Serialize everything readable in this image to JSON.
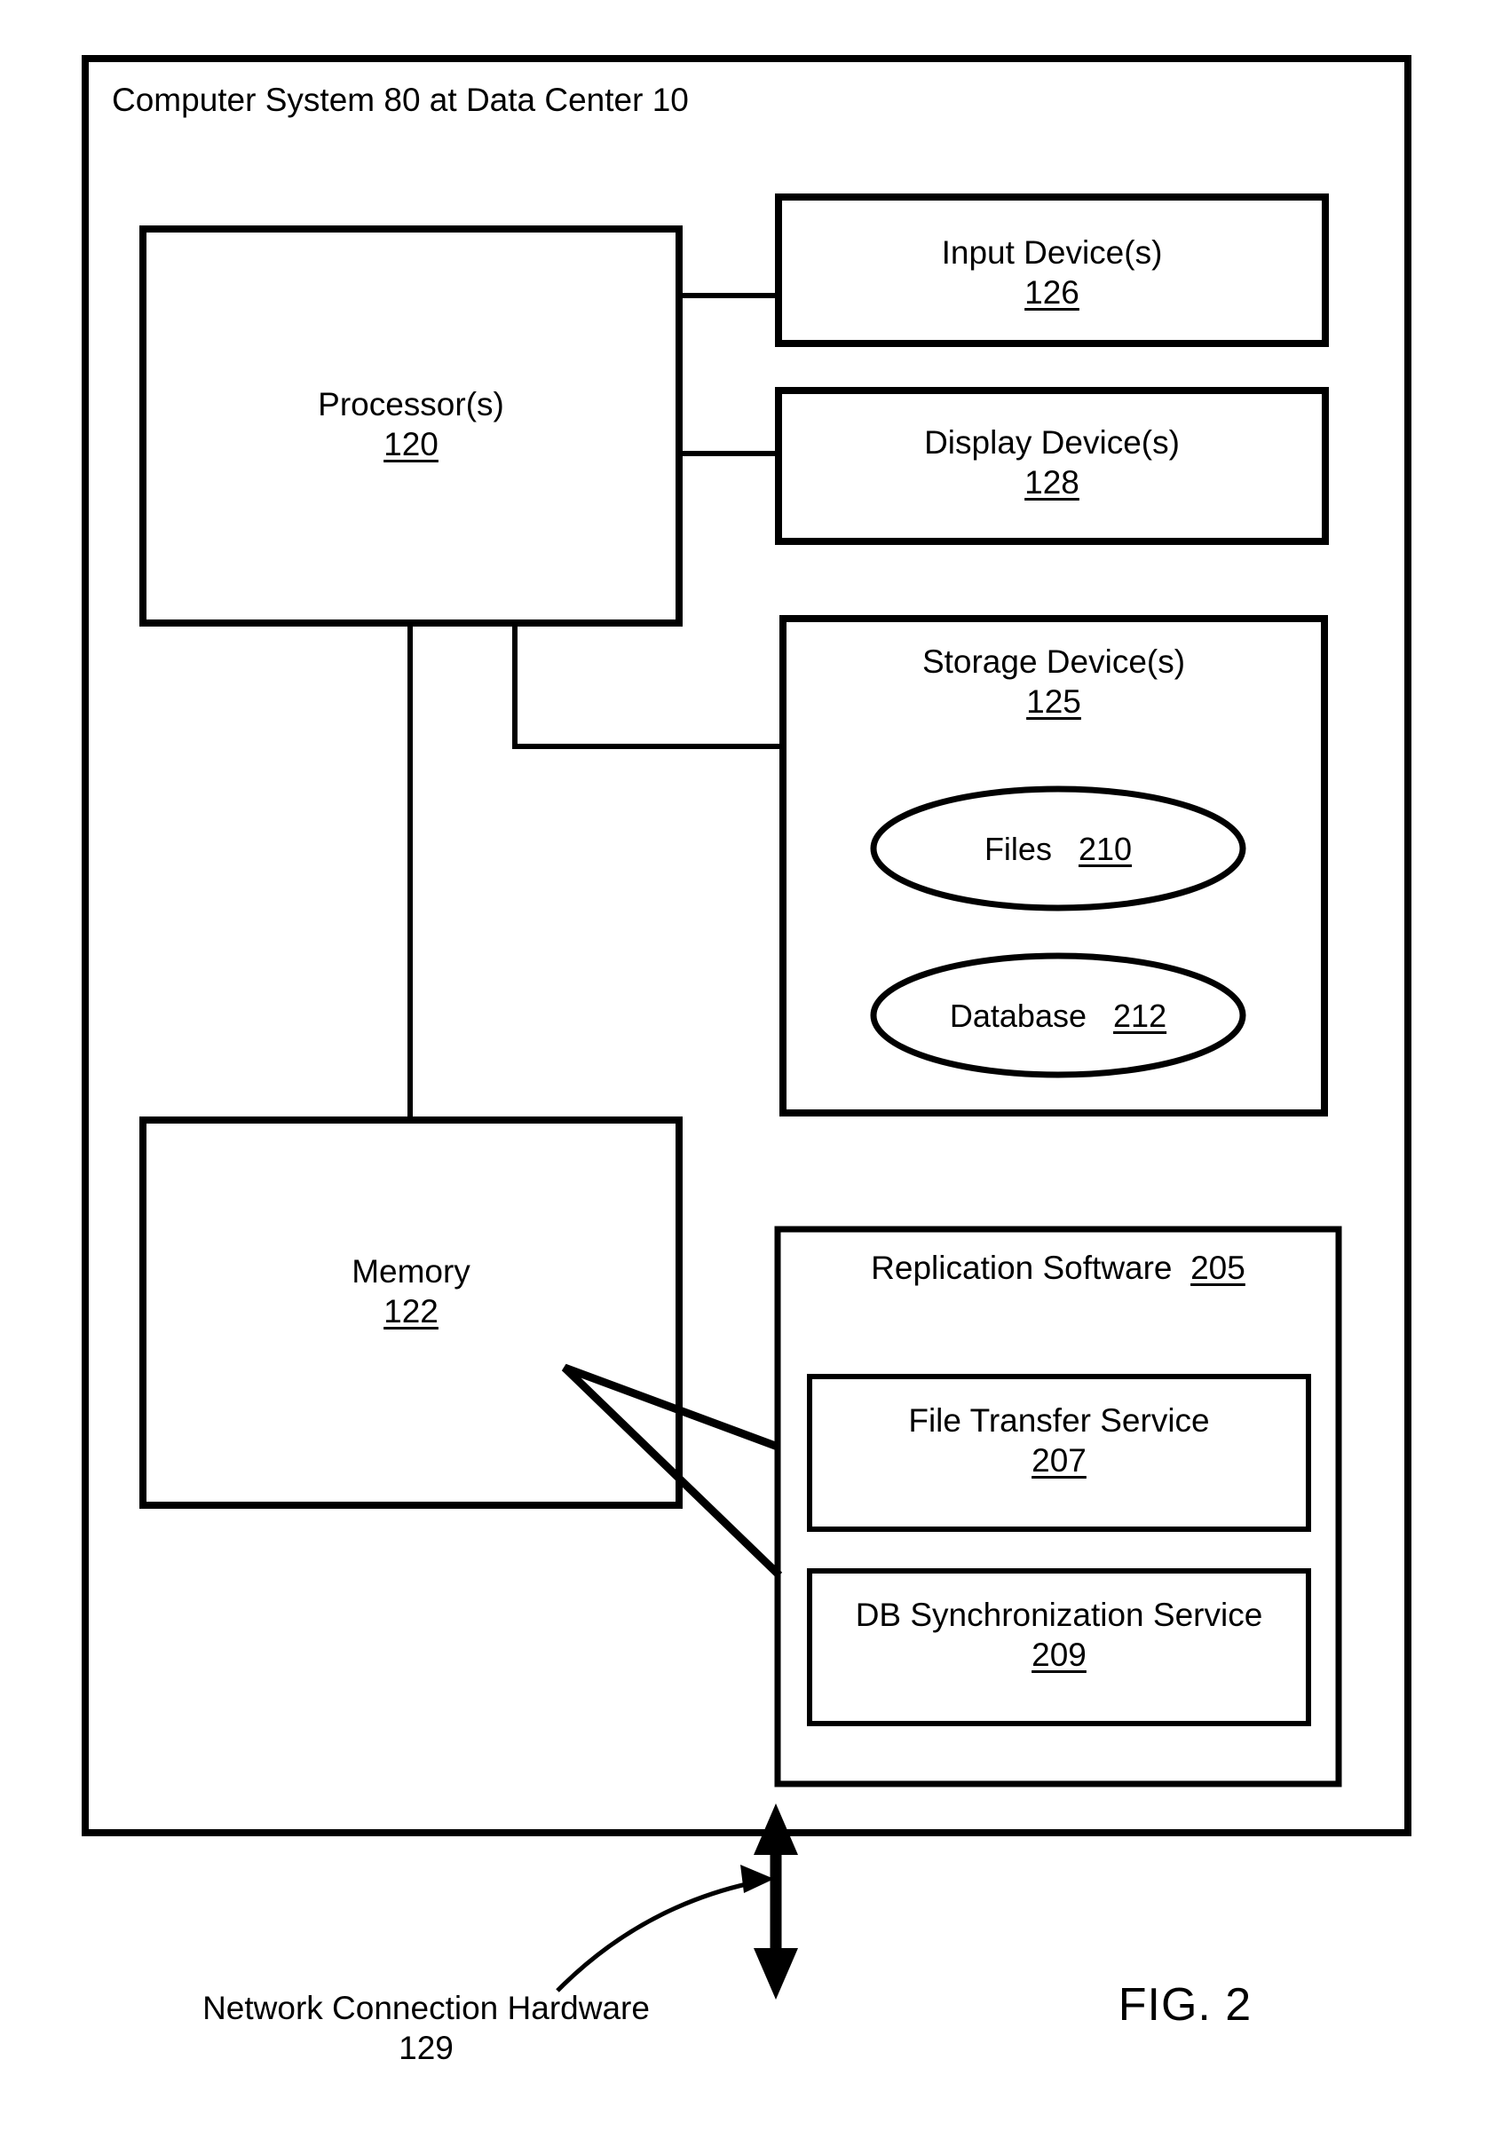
{
  "figure": {
    "caption": "FIG. 2",
    "outer_container_title": "Computer System 80 at Data Center 10"
  },
  "blocks": {
    "processor": {
      "label": "Processor(s)",
      "ref": "120",
      "ref_underlined": true
    },
    "input_devices": {
      "label": "Input Device(s)",
      "ref": "126",
      "ref_underlined": true
    },
    "display_devices": {
      "label": "Display Device(s)",
      "ref": "128",
      "ref_underlined": true
    },
    "storage_devices": {
      "label": "Storage Device(s)",
      "ref": "125",
      "ref_underlined": true
    },
    "memory": {
      "label": "Memory",
      "ref": "122",
      "ref_underlined": true
    },
    "replication_software": {
      "label": "Replication Software",
      "ref": "205",
      "ref_underlined": true
    },
    "file_transfer_service": {
      "label": "File Transfer Service",
      "ref": "207",
      "ref_underlined": true
    },
    "db_synchronization_service": {
      "label": "DB Synchronization Service",
      "ref": "209",
      "ref_underlined": true
    }
  },
  "ellipses": {
    "files": {
      "label": "Files",
      "ref": "210",
      "ref_underlined": true
    },
    "database": {
      "label": "Database",
      "ref": "212",
      "ref_underlined": true
    }
  },
  "annotations": {
    "network_connection_hardware": {
      "label": "Network Connection Hardware",
      "ref": "129",
      "ref_underlined": false
    }
  },
  "colors": {
    "stroke": "#000000",
    "background": "#ffffff",
    "text": "#000000"
  }
}
